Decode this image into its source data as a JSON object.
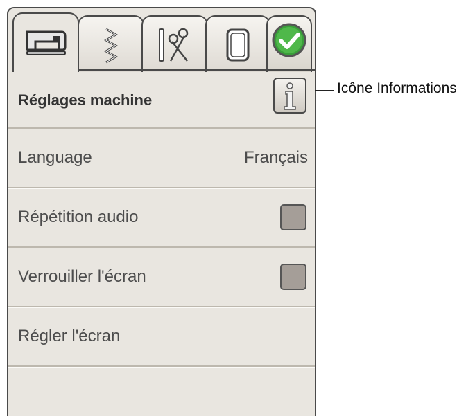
{
  "tabs": [
    {
      "icon": "sewing-machine-icon"
    },
    {
      "icon": "zigzag-stitch-icon"
    },
    {
      "icon": "scissors-tools-icon"
    },
    {
      "icon": "embroidery-hoop-icon"
    },
    {
      "icon": "confirm-check-icon"
    }
  ],
  "header": {
    "title": "Réglages machine",
    "info_icon": "info-icon"
  },
  "settings": {
    "language_label": "Language",
    "language_value": "Français",
    "audio_label": "Répétition audio",
    "lock_label": "Verrouiller l'écran",
    "adjust_label": "Régler l'écran"
  },
  "callout": {
    "text": "Icône Informations"
  },
  "colors": {
    "panel": "#e9e6e0",
    "checkbox": "#a59e98",
    "check_green": "#3a9e3a"
  }
}
